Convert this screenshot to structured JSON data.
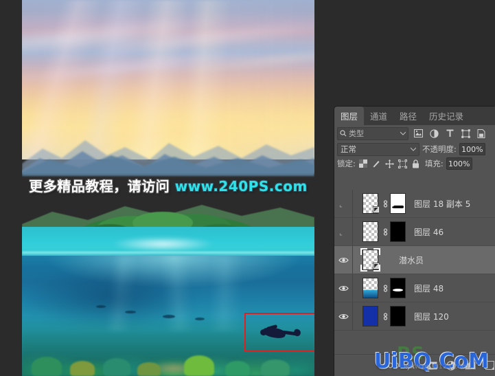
{
  "app": {
    "canvas_watermark": {
      "text_cn": "更多精品教程，请访问",
      "url": "www.240PS.com"
    },
    "site_watermark": {
      "main": "UiBQ.CoM",
      "sub": "www.psah123.com",
      "overlay": "PS"
    }
  },
  "panel": {
    "tabs": [
      {
        "label": "图层",
        "name": "tab-layers",
        "active": true
      },
      {
        "label": "通道",
        "name": "tab-channels",
        "active": false
      },
      {
        "label": "路径",
        "name": "tab-paths",
        "active": false
      },
      {
        "label": "历史记录",
        "name": "tab-history",
        "active": false
      }
    ],
    "filter": {
      "kind_label": "类型",
      "icons": [
        "pixel-filter-icon",
        "adjustment-filter-icon",
        "type-filter-icon",
        "shape-filter-icon",
        "smart-object-filter-icon"
      ]
    },
    "blend": {
      "mode": "正常",
      "opacity_label": "不透明度:",
      "opacity_value": "100%"
    },
    "lock": {
      "label": "锁定:",
      "icons": [
        "lock-transparent-icon",
        "lock-image-icon",
        "lock-position-icon",
        "lock-artboard-icon",
        "lock-all-icon"
      ],
      "fill_label": "填充:",
      "fill_value": "100%"
    },
    "layers": [
      {
        "name": "图层 18 副本 5",
        "visible": false,
        "selected": false,
        "has_mask": true,
        "mask_color": "#ffffff",
        "smart_object": true,
        "thumb_type": "transparent"
      },
      {
        "name": "图层 46",
        "visible": false,
        "selected": false,
        "has_mask": true,
        "mask_color": "#000000",
        "smart_object": false,
        "thumb_type": "transparent"
      },
      {
        "name": "潜水员",
        "visible": true,
        "selected": true,
        "has_mask": false,
        "mask_color": "",
        "smart_object": true,
        "thumb_type": "transparent"
      },
      {
        "name": "图层 48",
        "visible": true,
        "selected": false,
        "has_mask": true,
        "mask_color": "#000000",
        "smart_object": false,
        "thumb_type": "ocean"
      },
      {
        "name": "图层 120",
        "visible": true,
        "selected": false,
        "has_mask": true,
        "mask_color": "#000000",
        "smart_object": false,
        "thumb_type": "blue"
      }
    ],
    "bottom_icons": [
      "link-layers-icon",
      "layer-style-fx-icon",
      "add-mask-icon",
      "adjustment-layer-icon",
      "new-group-icon",
      "new-layer-icon"
    ]
  },
  "colors": {
    "panel_bg": "#535353",
    "tab_bar": "#3b3b3b",
    "selected_row": "#6a6a6a",
    "app_bg": "#2b2b2b",
    "selection_rect": "#e02020",
    "watermark_cyan": "#2fe3ea",
    "watermark_blue": "#2a66d8"
  }
}
